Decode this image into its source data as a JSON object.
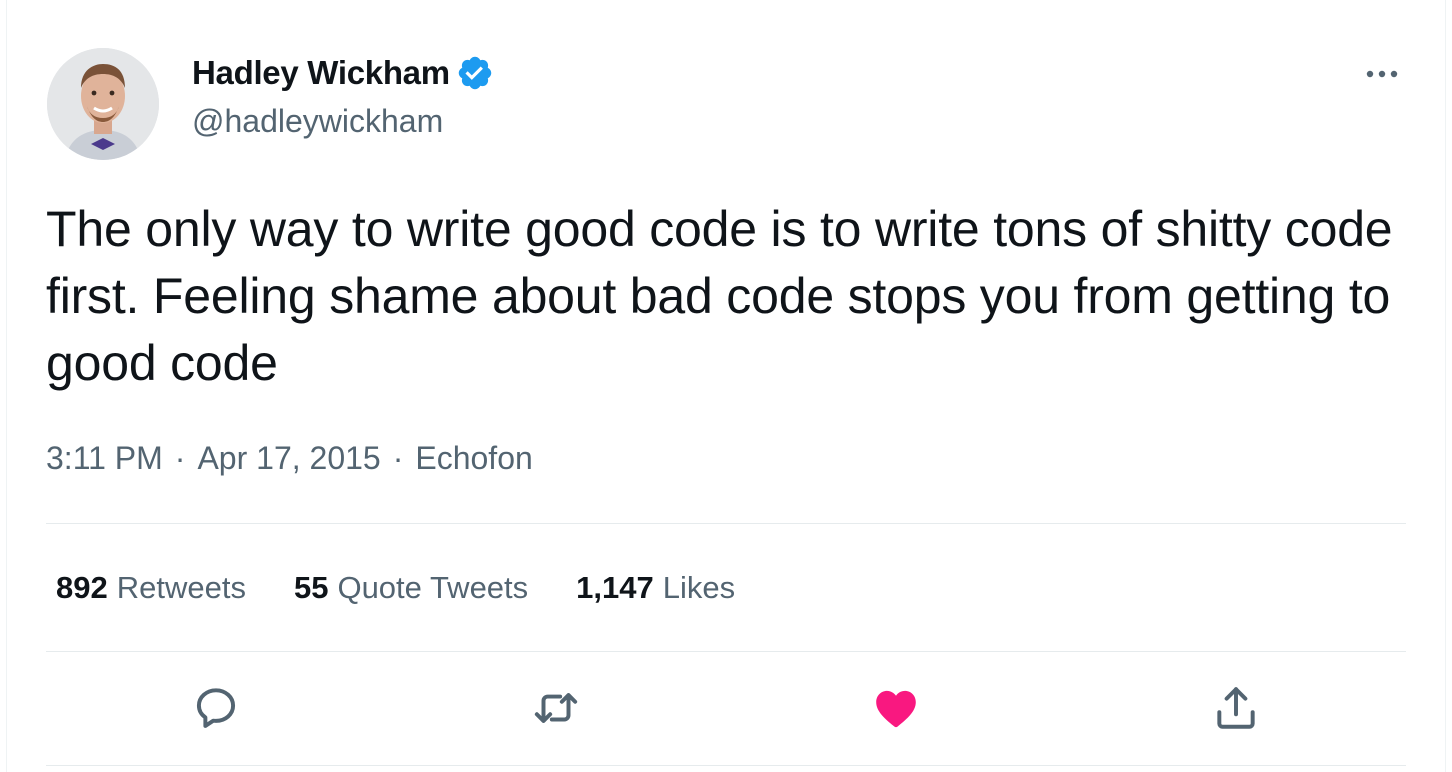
{
  "tweet": {
    "author": {
      "display_name": "Hadley Wickham",
      "handle": "@hadleywickham",
      "verified": true
    },
    "text": "The only way to write good code is to write tons of shitty code first. Feeling shame about bad code stops you from getting to good code",
    "time": "3:11 PM",
    "date": "Apr 17, 2015",
    "source": "Echofon",
    "separator": "·"
  },
  "stats": {
    "retweets": {
      "count": "892",
      "label": "Retweets"
    },
    "quote_tweets": {
      "count": "55",
      "label": "Quote Tweets"
    },
    "likes": {
      "count": "1,147",
      "label": "Likes"
    }
  },
  "icons": {
    "more": "more-icon",
    "verified": "verified-badge-icon",
    "reply": "reply-icon",
    "retweet": "retweet-icon",
    "like": "heart-icon",
    "share": "share-icon"
  },
  "colors": {
    "text_primary": "#0f1419",
    "text_secondary": "#536471",
    "verified_blue": "#1d9bf0",
    "like_pink": "#f91880",
    "divider": "#e6ebed"
  }
}
